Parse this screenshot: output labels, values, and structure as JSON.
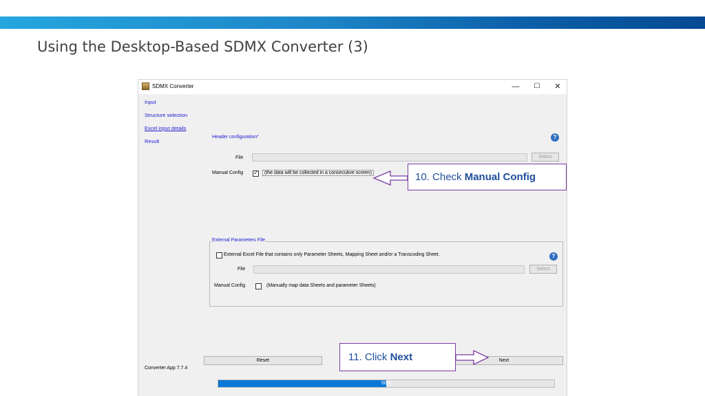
{
  "slide": {
    "title": "Using the Desktop-Based SDMX Converter (3)"
  },
  "window": {
    "title": "SDMX Converter",
    "controls": {
      "minimize": "—",
      "maximize": "☐",
      "close": "✕"
    }
  },
  "nav": {
    "items": [
      {
        "label": "Input"
      },
      {
        "label": "Structure selection"
      },
      {
        "label": "Excel input details"
      },
      {
        "label": "Result"
      }
    ]
  },
  "header_config": {
    "title": "Header configuration*",
    "file_label": "File",
    "file_value": "",
    "select_label": "Select",
    "manual_config_label": "Manual Config",
    "manual_config_checked": true,
    "manual_config_note": "(the data will be collected in a consecutive screen)"
  },
  "external_params": {
    "legend": "External Parameters File",
    "checkbox_label": "External Excel File that contains only Parameter Sheets, Mapping Sheet and/or a Transcoding Sheet.",
    "file_label": "File",
    "select_label": "Select",
    "manual_config_label": "Manual Config",
    "manual_config_note": "(Manually map data Sheets and parameter Sheets)"
  },
  "footer": {
    "version": "Converter App 7.7.4",
    "reset_label": "Reset",
    "next_label": "Next",
    "progress_text": "50%",
    "progress_value": 0.5
  },
  "callouts": {
    "step10_prefix": "10. Check ",
    "step10_bold": "Manual Config",
    "step11_prefix": "11. Click ",
    "step11_bold": "Next",
    "color": "#7a3aa0"
  }
}
